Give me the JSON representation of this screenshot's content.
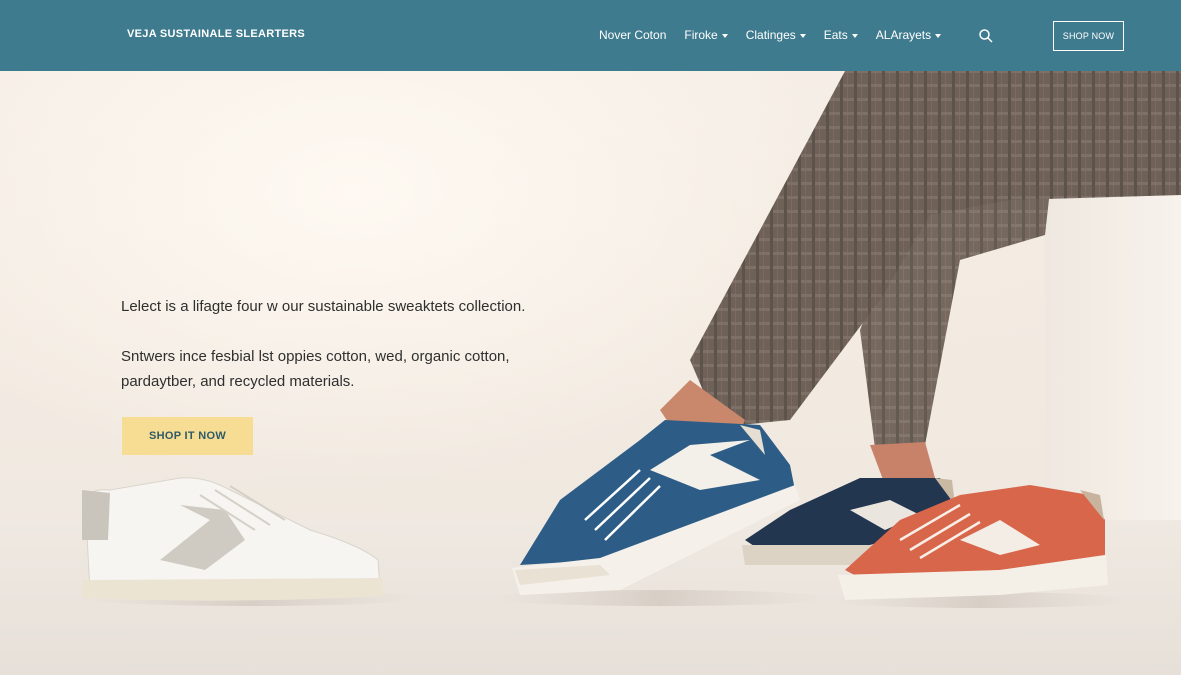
{
  "header": {
    "brand": "VEJA SUSTAINALE SLEARTERS",
    "nav": [
      {
        "label": "Nover Coton",
        "dropdown": false
      },
      {
        "label": "Firoke",
        "dropdown": true
      },
      {
        "label": "Clatinges",
        "dropdown": true
      },
      {
        "label": "Eats",
        "dropdown": true
      },
      {
        "label": "ALArayets",
        "dropdown": true
      }
    ],
    "search_icon": "search-icon",
    "shop_button": "SHOP NOW"
  },
  "hero": {
    "headline": "Lelect is a lifagte four w our sustainable sweaktets collection.",
    "body": "Sntwers ince fesbial lst oppies cotton, wed, organic cotton, pardaytber, and recycled materials.",
    "cta": "SHOP IT NOW"
  },
  "colors": {
    "header": "#3f7b8e",
    "cta": "#f7dd93",
    "cta_text": "#2e5b68",
    "background": "#f6efe7"
  },
  "scene": {
    "items": [
      "white-silver-sneaker",
      "blue-sneaker",
      "navy-sneaker",
      "coral-sneaker",
      "legs-in-plaid-trousers"
    ]
  }
}
